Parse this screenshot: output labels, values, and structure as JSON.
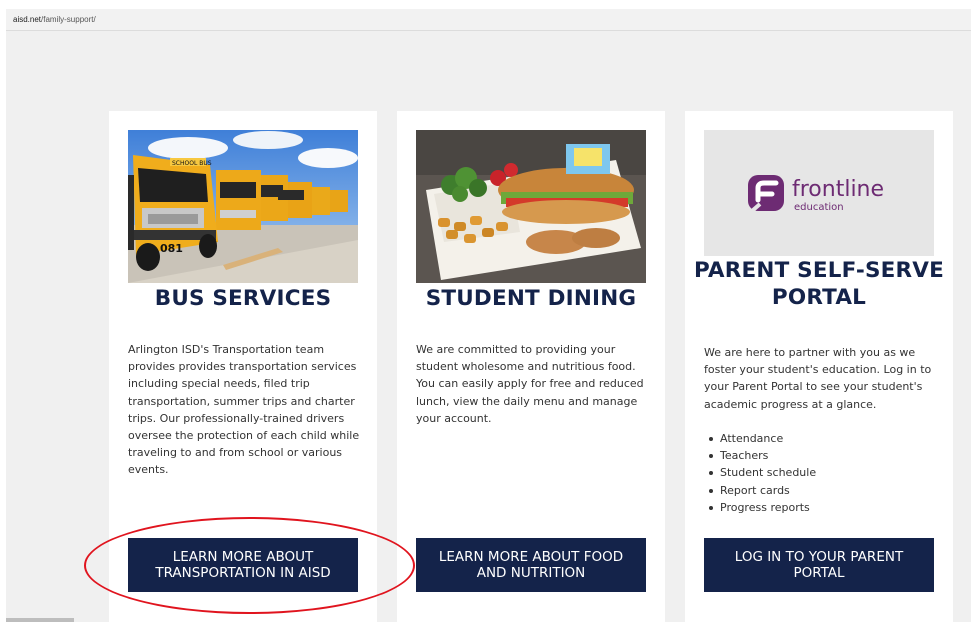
{
  "browser": {
    "url_host": "aisd.net",
    "url_path": "/family-support/"
  },
  "cards": [
    {
      "title": "BUS SERVICES",
      "description": "Arlington ISD's Transportation team provides provides transportation services including special needs, filed trip transportation, summer trips and charter trips. Our professionally-trained drivers oversee the protection of each child while traveling to and from school or various events.",
      "button_label": "LEARN MORE ABOUT TRANSPORTATION IN AISD",
      "bus_number": "081",
      "bus_sign": "SCHOOL BUS"
    },
    {
      "title": "STUDENT DINING",
      "description": "We are committed to providing your student wholesome and nutritious food. You can easily apply for free and reduced lunch, view the daily menu and manage your account.",
      "button_label": "LEARN MORE ABOUT FOOD AND NUTRITION"
    },
    {
      "title": "PARENT SELF-SERVE PORTAL",
      "description": "We are here to partner with you as we foster your student's education. Log in to your Parent Portal to see your student's academic progress at a glance.",
      "list": [
        "Attendance",
        "Teachers",
        "Student schedule",
        "Report cards",
        "Progress reports"
      ],
      "button_label": "LOG IN TO YOUR PARENT PORTAL",
      "logo": {
        "name": "frontline",
        "sub": "education",
        "color": "#6d2b73"
      }
    }
  ],
  "colors": {
    "button_bg": "#14234a",
    "heading": "#14234a",
    "annotation": "#e0141e"
  }
}
